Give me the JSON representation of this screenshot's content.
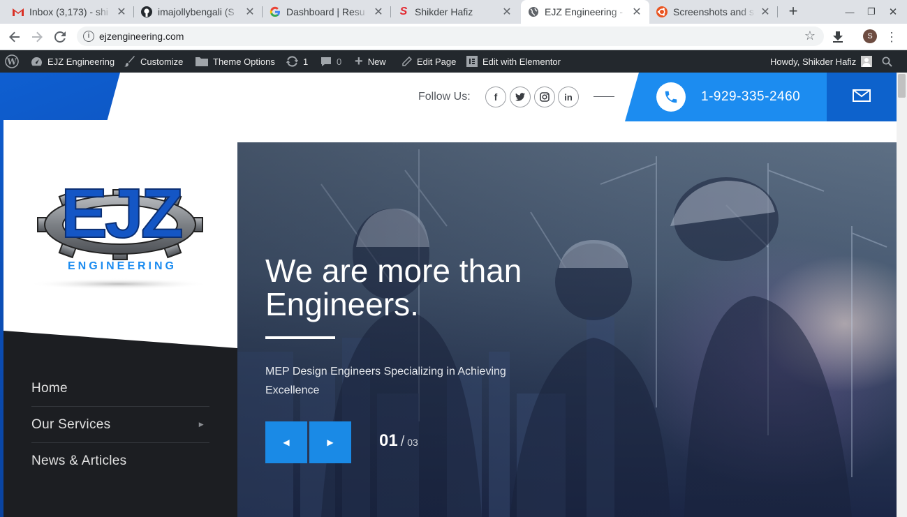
{
  "browser": {
    "tabs": [
      {
        "title": "Inbox (3,173) - shi",
        "icon": "gmail-icon"
      },
      {
        "title": "imajollybengali (S",
        "icon": "github-icon"
      },
      {
        "title": "Dashboard | Resu",
        "icon": "google-icon"
      },
      {
        "title": "Shikder Hafiz",
        "icon": "s-logo-icon"
      },
      {
        "title": "EJZ Engineering -",
        "icon": "globe-icon",
        "active": true
      },
      {
        "title": "Screenshots and s",
        "icon": "ubuntu-icon"
      }
    ],
    "url": "ejzengineering.com",
    "profile_initial": "S"
  },
  "admin_bar": {
    "site": "EJZ Engineering",
    "customize": "Customize",
    "theme_options": "Theme Options",
    "updates": "1",
    "comments": "0",
    "new": "New",
    "edit_page": "Edit Page",
    "edit_elementor": "Edit with Elementor",
    "howdy": "Howdy, Shikder Hafiz"
  },
  "header": {
    "follow_label": "Follow Us:",
    "social": [
      "facebook",
      "twitter",
      "instagram",
      "linkedin"
    ],
    "phone": "1-929-335-2460"
  },
  "logo": {
    "letters": "EJZ",
    "word": "ENGINEERING"
  },
  "nav": {
    "items": [
      {
        "label": "Home"
      },
      {
        "label": "Our Services"
      },
      {
        "label": "News & Articles"
      }
    ]
  },
  "hero": {
    "title": "We are more than Engineers.",
    "subtitle": "MEP Design Engineers Specializing in Achieving Excellence",
    "slide_current": "01",
    "slide_separator": "/",
    "slide_total": "03"
  },
  "colors": {
    "brand_blue": "#0d62cc",
    "accent_blue": "#1c8cf0",
    "nav_dark": "#1c1e22"
  }
}
